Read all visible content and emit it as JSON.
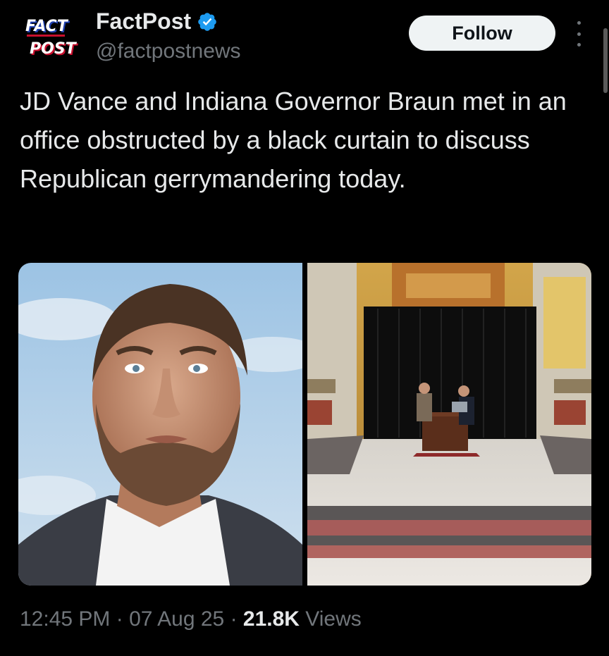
{
  "account": {
    "display_name": "FactPost",
    "handle": "@factpostnews",
    "verified": true,
    "logo_line1": "FACT",
    "logo_line2": "POST",
    "verified_color": "#1d9bf0"
  },
  "actions": {
    "follow_label": "Follow",
    "more_icon": "more-vertical-icon"
  },
  "tweet": {
    "text": "JD Vance and Indiana Governor Braun met in an office obstructed by a black curtain to discuss Republican gerrymandering today."
  },
  "media": {
    "count": 2
  },
  "meta": {
    "time": "12:45 PM",
    "sep1": " · ",
    "date": "07 Aug 25",
    "sep2": " · ",
    "views_count": "21.8K",
    "views_label": " Views"
  }
}
